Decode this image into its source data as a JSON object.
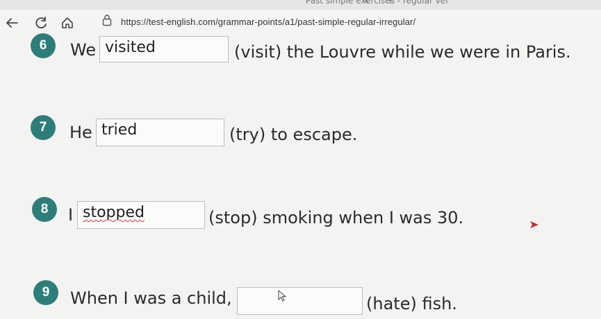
{
  "browser": {
    "tab_title": "Past simple exercises - regular ver",
    "tab_close": "×",
    "tab_new": "+",
    "url": "https://test-english.com/grammar-points/a1/past-simple-regular-irregular/"
  },
  "colors": {
    "badge": "#2d7d79",
    "box_border": "#bcbcbc",
    "spell_underline": "#d33"
  },
  "exercises": [
    {
      "number": "6",
      "before": "We",
      "answer": "visited",
      "after": "(visit) the Louvre while we were in Paris."
    },
    {
      "number": "7",
      "before": "He",
      "answer": "tried",
      "after": "(try) to escape."
    },
    {
      "number": "8",
      "before": "I",
      "answer": "stopped",
      "after": "(stop) smoking when I was 30."
    },
    {
      "number": "9",
      "before": "When I was a child, I",
      "answer": "",
      "after": "(hate) fish."
    }
  ]
}
